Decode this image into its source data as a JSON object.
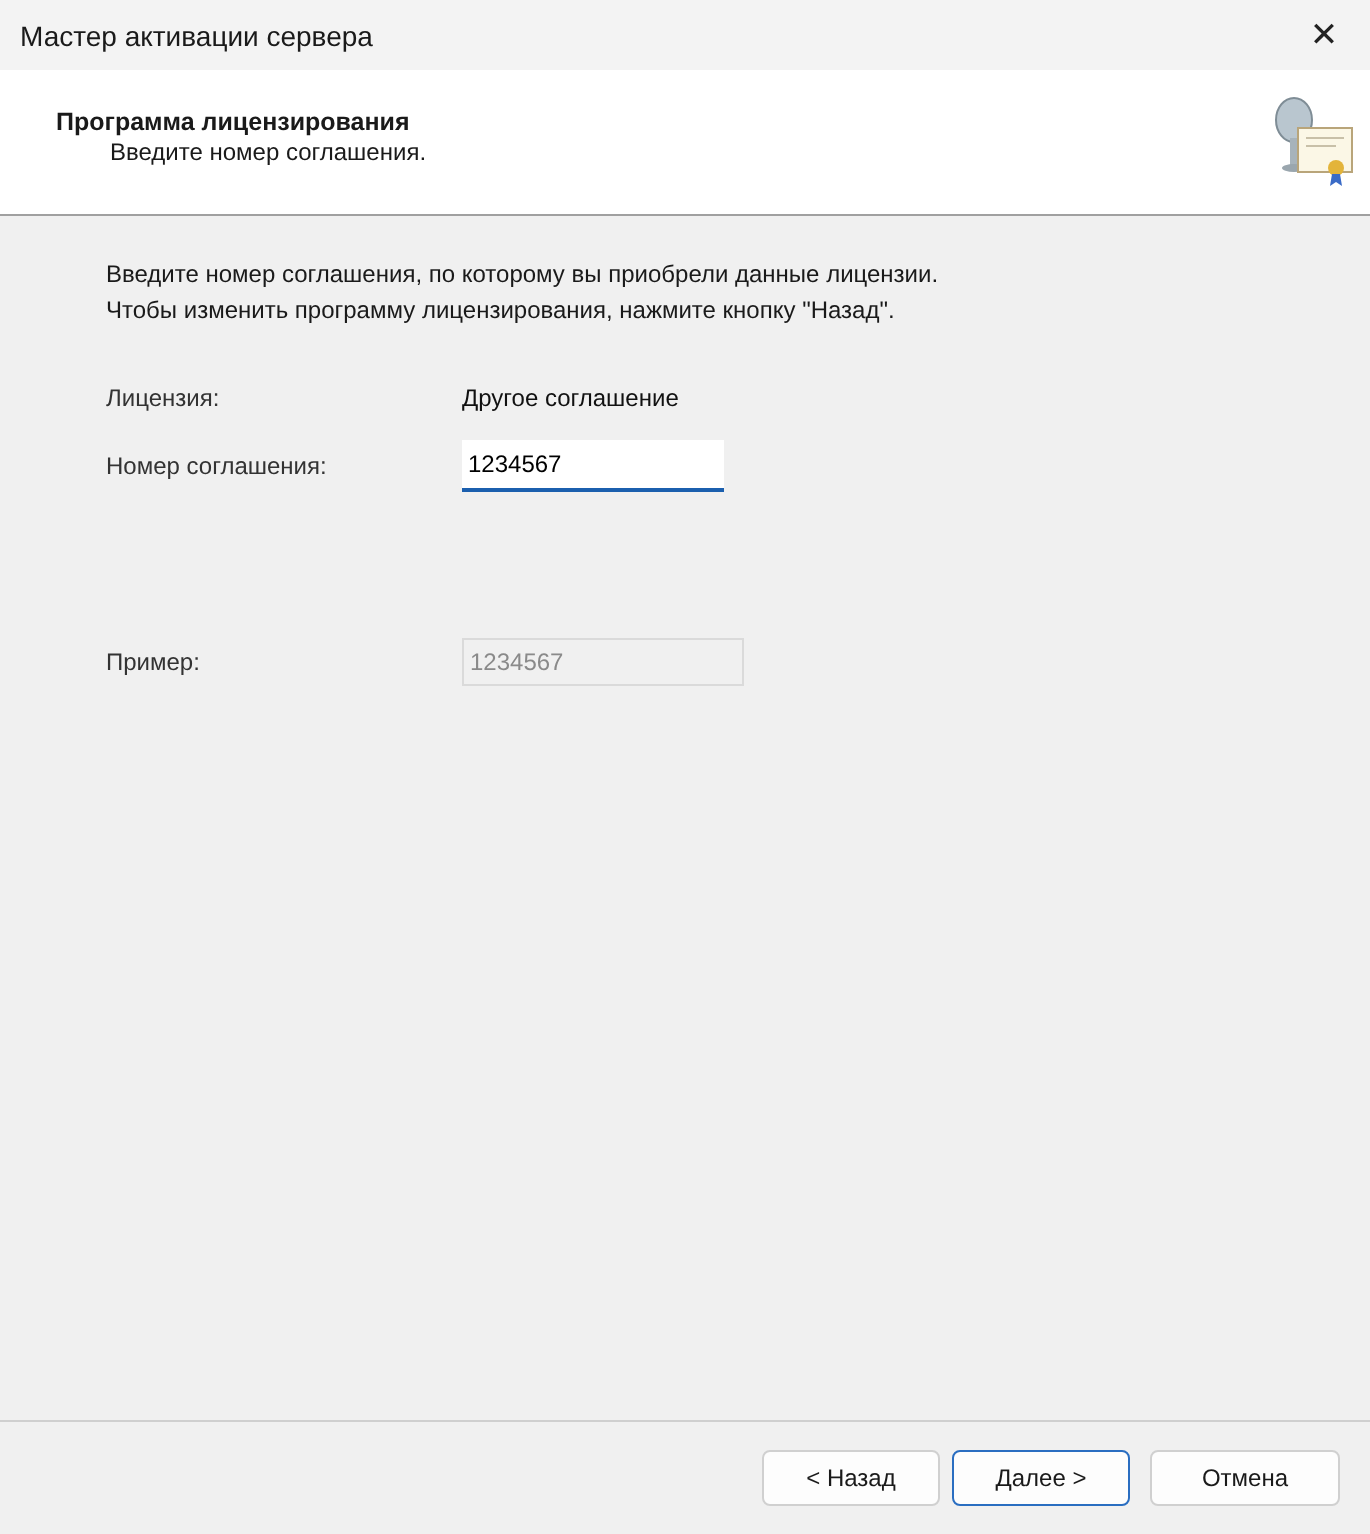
{
  "window": {
    "title": "Мастер активации сервера",
    "close": "✕"
  },
  "header": {
    "title": "Программа лицензирования",
    "subtitle": "Введите номер соглашения."
  },
  "intro": [
    "Введите номер соглашения, по которому вы приобрели данные лицензии.",
    "Чтобы изменить программу лицензирования, нажмите кнопку \"Назад\"."
  ],
  "fields": [
    {
      "kind": "text",
      "label": "Лицензия:",
      "value": "Другое соглашение"
    },
    {
      "kind": "input",
      "label": "Номер соглашения:",
      "value": "1234567",
      "disabled": false
    },
    {
      "kind": "spacer"
    },
    {
      "kind": "input",
      "label": "Пример:",
      "value": "1234567",
      "disabled": true
    }
  ],
  "buttons": [
    {
      "label": "< Назад",
      "default": false
    },
    {
      "label": "Далее >",
      "default": true
    },
    {
      "label": "Отмена",
      "default": false
    }
  ]
}
